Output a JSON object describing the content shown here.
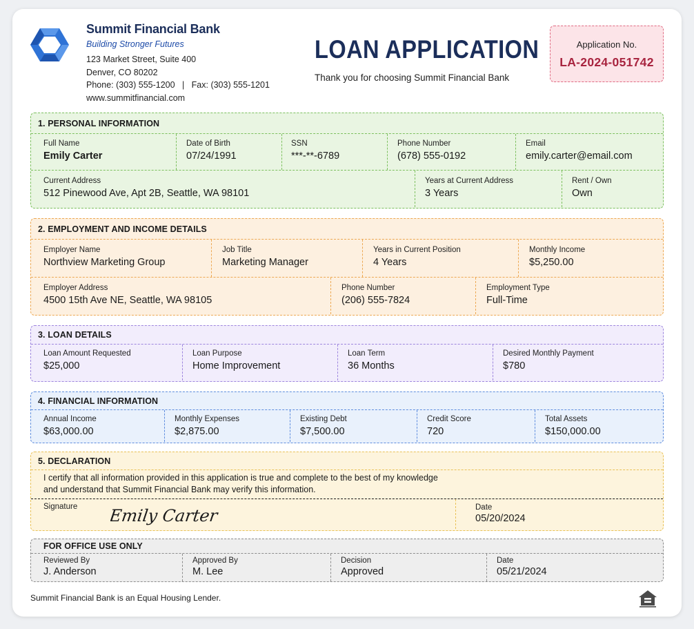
{
  "header": {
    "bank_name": "Summit Financial Bank",
    "tagline": "Building Stronger Futures",
    "address_line1": "123 Market Street, Suite 400",
    "address_line2": "Denver, CO 80202",
    "contact_line": "Phone: (303) 555-1200   |   Fax: (303) 555-1201",
    "website": "www.summitfinancial.com",
    "title": "LOAN APPLICATION",
    "subtitle": "Thank you for choosing Summit Financial Bank",
    "application_no_label": "Application No.",
    "application_no": "LA-2024-051742"
  },
  "personal": {
    "heading": "1. PERSONAL INFORMATION",
    "full_name_label": "Full Name",
    "full_name": "Emily Carter",
    "dob_label": "Date of Birth",
    "dob": "07/24/1991",
    "ssn_label": "SSN",
    "ssn": "***-**-6789",
    "phone_label": "Phone Number",
    "phone": "(678) 555-0192",
    "email_label": "Email",
    "email": "emily.carter@email.com",
    "address_label": "Current Address",
    "address": "512 Pinewood Ave, Apt 2B, Seattle, WA 98101",
    "years_label": "Years at Current Address",
    "years": "3 Years",
    "rent_own_label": "Rent / Own",
    "rent_own": "Own"
  },
  "employment": {
    "heading": "2. EMPLOYMENT AND INCOME DETAILS",
    "employer_label": "Employer Name",
    "employer": "Northview Marketing Group",
    "job_title_label": "Job Title",
    "job_title": "Marketing Manager",
    "years_label": "Years in Current Position",
    "years": "4 Years",
    "income_label": "Monthly Income",
    "income": "$5,250.00",
    "employer_address_label": "Employer Address",
    "employer_address": "4500 15th Ave NE, Seattle, WA 98105",
    "phone_label": "Phone Number",
    "phone": "(206) 555-7824",
    "type_label": "Employment Type",
    "type": "Full-Time"
  },
  "loan": {
    "heading": "3. LOAN DETAILS",
    "amount_label": "Loan Amount Requested",
    "amount": "$25,000",
    "purpose_label": "Loan Purpose",
    "purpose": "Home Improvement",
    "term_label": "Loan Term",
    "term": "36 Months",
    "payment_label": "Desired Monthly Payment",
    "payment": "$780"
  },
  "financial": {
    "heading": "4. FINANCIAL INFORMATION",
    "annual_income_label": "Annual Income",
    "annual_income": "$63,000.00",
    "expenses_label": "Monthly Expenses",
    "expenses": "$2,875.00",
    "debt_label": "Existing Debt",
    "debt": "$7,500.00",
    "credit_label": "Credit Score",
    "credit": "720",
    "assets_label": "Total Assets",
    "assets": "$150,000.00"
  },
  "declaration": {
    "heading": "5. DECLARATION",
    "text_line1": "I certify that all information provided in this application is true and complete to the best of my knowledge",
    "text_line2": "and understand that Summit Financial Bank may verify this information.",
    "signature_label": "Signature",
    "signature": "Emily Carter",
    "date_label": "Date",
    "date": "05/20/2024"
  },
  "office": {
    "heading": "FOR OFFICE USE ONLY",
    "reviewed_label": "Reviewed By",
    "reviewed": "J. Anderson",
    "approved_label": "Approved By",
    "approved": "M. Lee",
    "decision_label": "Decision",
    "decision": "Approved",
    "date_label": "Date",
    "date": "05/21/2024"
  },
  "footer": {
    "text": "Summit Financial Bank is an Equal Housing Lender.",
    "icon": "equal-housing-icon"
  },
  "colors": {
    "brand_navy": "#1b2e5a",
    "brand_blue": "#1d4ba8",
    "personal_bg": "#e9f5e2",
    "employment_bg": "#fdf0e0",
    "loan_bg": "#f2edfc",
    "financial_bg": "#e9f1fc",
    "declaration_bg": "#fdf4dd",
    "office_bg": "#eeeeee",
    "app_no_accent": "#a8243f"
  }
}
